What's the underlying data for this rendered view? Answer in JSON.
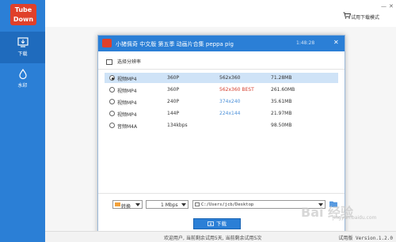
{
  "app": {
    "logo_line1": "Tube",
    "logo_line2": "Down"
  },
  "sidebar": {
    "items": [
      {
        "label": "下载",
        "icon": "download-icon",
        "active": true
      },
      {
        "label": "水印",
        "icon": "droplet-icon",
        "active": false
      }
    ]
  },
  "topbar": {
    "mode_label": "试用下载模式"
  },
  "dialog": {
    "title": "小猪佩奇 中文版 第五季 动画片合集 peppa pig",
    "time": "1:48:28",
    "choose_label": "选择分辨率",
    "rows": [
      {
        "format": "视频MP4",
        "quality": "360P",
        "resolution": "562x360",
        "size": "71.28MB",
        "selected": true,
        "res_color": "normal"
      },
      {
        "format": "视频MP4",
        "quality": "360P",
        "resolution": "562x360 BEST",
        "size": "261.60MB",
        "selected": false,
        "res_color": "red"
      },
      {
        "format": "视频MP4",
        "quality": "240P",
        "resolution": "374x240",
        "size": "35.61MB",
        "selected": false,
        "res_color": "blue"
      },
      {
        "format": "视频MP4",
        "quality": "144P",
        "resolution": "224x144",
        "size": "21.97MB",
        "selected": false,
        "res_color": "blue"
      },
      {
        "format": "音频M4A",
        "quality": "134kbps",
        "resolution": "",
        "size": "98.50MB",
        "selected": false,
        "res_color": "normal"
      }
    ],
    "transcode_label": "转换",
    "speed_value": "1 Mbps",
    "save_path": "C:/Users/jcb/Desktop",
    "download_label": "下载"
  },
  "footer": {
    "message": "欢迎用户, 当前剩余试用5天, 当前剩余试用5次",
    "version": "试用版 Version.1.2.0"
  },
  "watermark": {
    "text": "Bai 经验",
    "sub": "jingyan.baidu.com"
  },
  "colors": {
    "primary": "#2b7fd6",
    "logo": "#e0402a",
    "selected_row": "#cfe3f7",
    "best_red": "#d43b2a",
    "res_blue": "#4a8fd8"
  }
}
